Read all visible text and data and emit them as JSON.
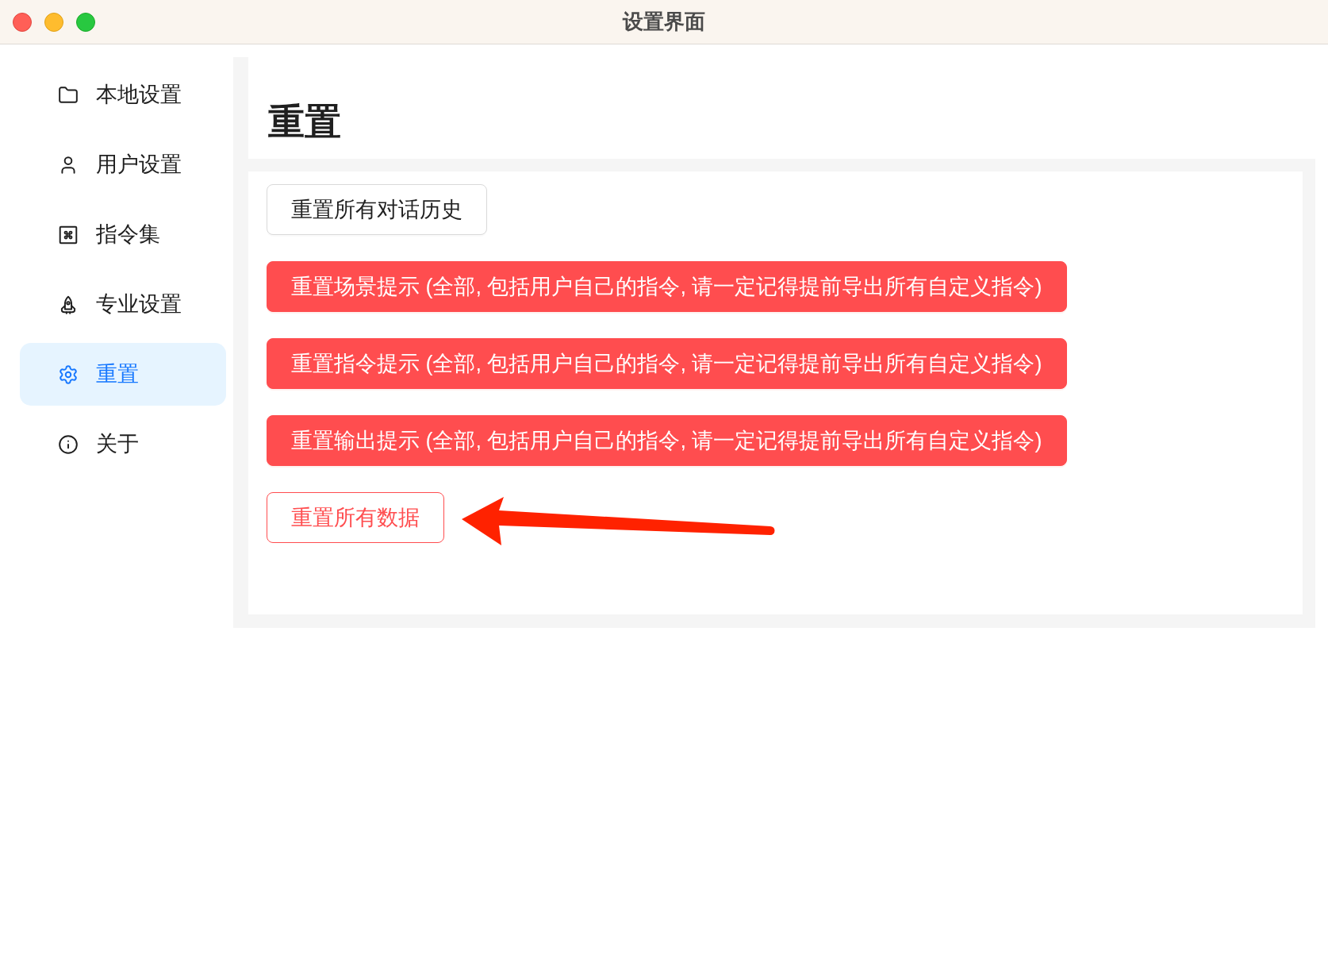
{
  "window": {
    "title": "设置界面"
  },
  "sidebar": {
    "items": [
      {
        "label": "本地设置",
        "selected": false
      },
      {
        "label": "用户设置",
        "selected": false
      },
      {
        "label": "指令集",
        "selected": false
      },
      {
        "label": "专业设置",
        "selected": false
      },
      {
        "label": "重置",
        "selected": true
      },
      {
        "label": "关于",
        "selected": false
      }
    ]
  },
  "page": {
    "title": "重置"
  },
  "actions": [
    {
      "label": "重置所有对话历史",
      "kind": "default"
    },
    {
      "label": "重置场景提示 (全部, 包括用户自己的指令, 请一定记得提前导出所有自定义指令)",
      "kind": "danger"
    },
    {
      "label": "重置指令提示 (全部, 包括用户自己的指令, 请一定记得提前导出所有自定义指令)",
      "kind": "danger"
    },
    {
      "label": "重置输出提示 (全部, 包括用户自己的指令, 请一定记得提前导出所有自定义指令)",
      "kind": "danger"
    },
    {
      "label": "重置所有数据",
      "kind": "danger-outline"
    }
  ]
}
